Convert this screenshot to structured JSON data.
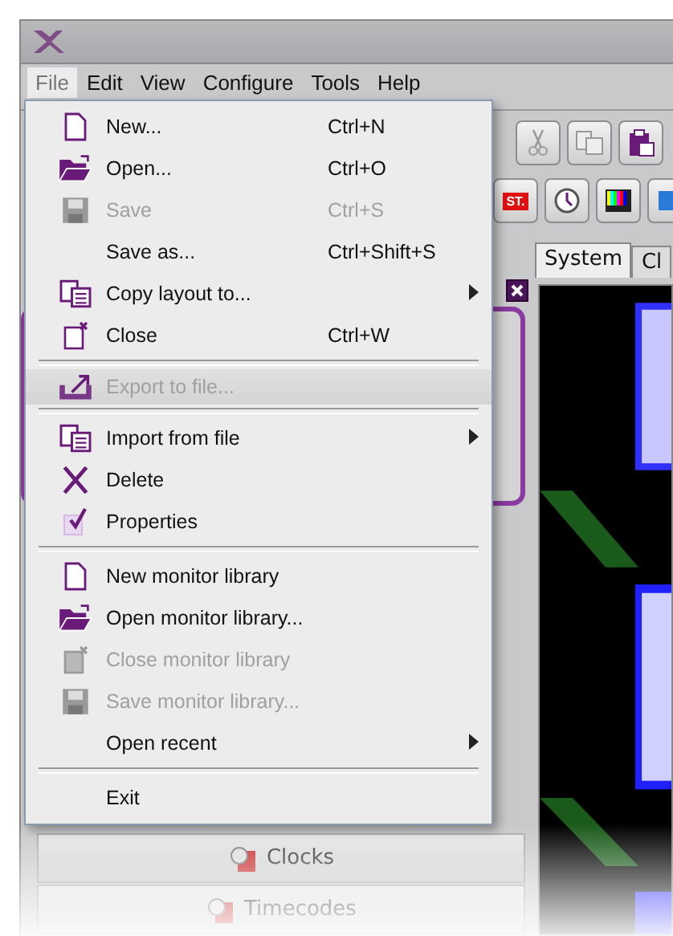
{
  "menubar": [
    {
      "label": "File",
      "selected": true
    },
    {
      "label": "Edit",
      "selected": false
    },
    {
      "label": "View",
      "selected": false
    },
    {
      "label": "Configure",
      "selected": false
    },
    {
      "label": "Tools",
      "selected": false
    },
    {
      "label": "Help",
      "selected": false
    }
  ],
  "file_menu": [
    {
      "kind": "new",
      "label": "New...",
      "shortcut": "Ctrl+N",
      "disabled": false
    },
    {
      "kind": "open",
      "label": "Open...",
      "shortcut": "Ctrl+O",
      "disabled": false
    },
    {
      "kind": "save",
      "label": "Save",
      "shortcut": "Ctrl+S",
      "disabled": true
    },
    {
      "kind": "plain",
      "label": "Save as...",
      "shortcut": "Ctrl+Shift+S",
      "disabled": false
    },
    {
      "kind": "copy",
      "label": "Copy layout to...",
      "submenu": true,
      "disabled": false
    },
    {
      "kind": "close",
      "label": "Close",
      "shortcut": "Ctrl+W",
      "disabled": false
    },
    {
      "kind": "separator"
    },
    {
      "kind": "export",
      "label": "Export to file...",
      "disabled": true,
      "highlighted": true
    },
    {
      "kind": "separator"
    },
    {
      "kind": "copy",
      "label": "Import from file",
      "submenu": true,
      "disabled": false
    },
    {
      "kind": "delete",
      "label": "Delete",
      "disabled": false
    },
    {
      "kind": "properties",
      "label": "Properties",
      "disabled": false
    },
    {
      "kind": "separator"
    },
    {
      "kind": "new",
      "label": "New monitor library",
      "disabled": false
    },
    {
      "kind": "open",
      "label": "Open monitor library...",
      "disabled": false
    },
    {
      "kind": "close",
      "label": "Close monitor library",
      "disabled": true
    },
    {
      "kind": "save",
      "label": "Save monitor library...",
      "disabled": true
    },
    {
      "kind": "plain",
      "label": "Open recent",
      "submenu": true,
      "disabled": false
    },
    {
      "kind": "separator"
    },
    {
      "kind": "plain",
      "label": "Exit",
      "disabled": false
    }
  ],
  "toolbar_2": {
    "badge": "ST."
  },
  "tabs": [
    {
      "label": "System",
      "selected": true
    },
    {
      "label": "Cl",
      "selected": false
    }
  ],
  "left_list": [
    {
      "label": "Clocks"
    },
    {
      "label": "Timecodes"
    }
  ]
}
